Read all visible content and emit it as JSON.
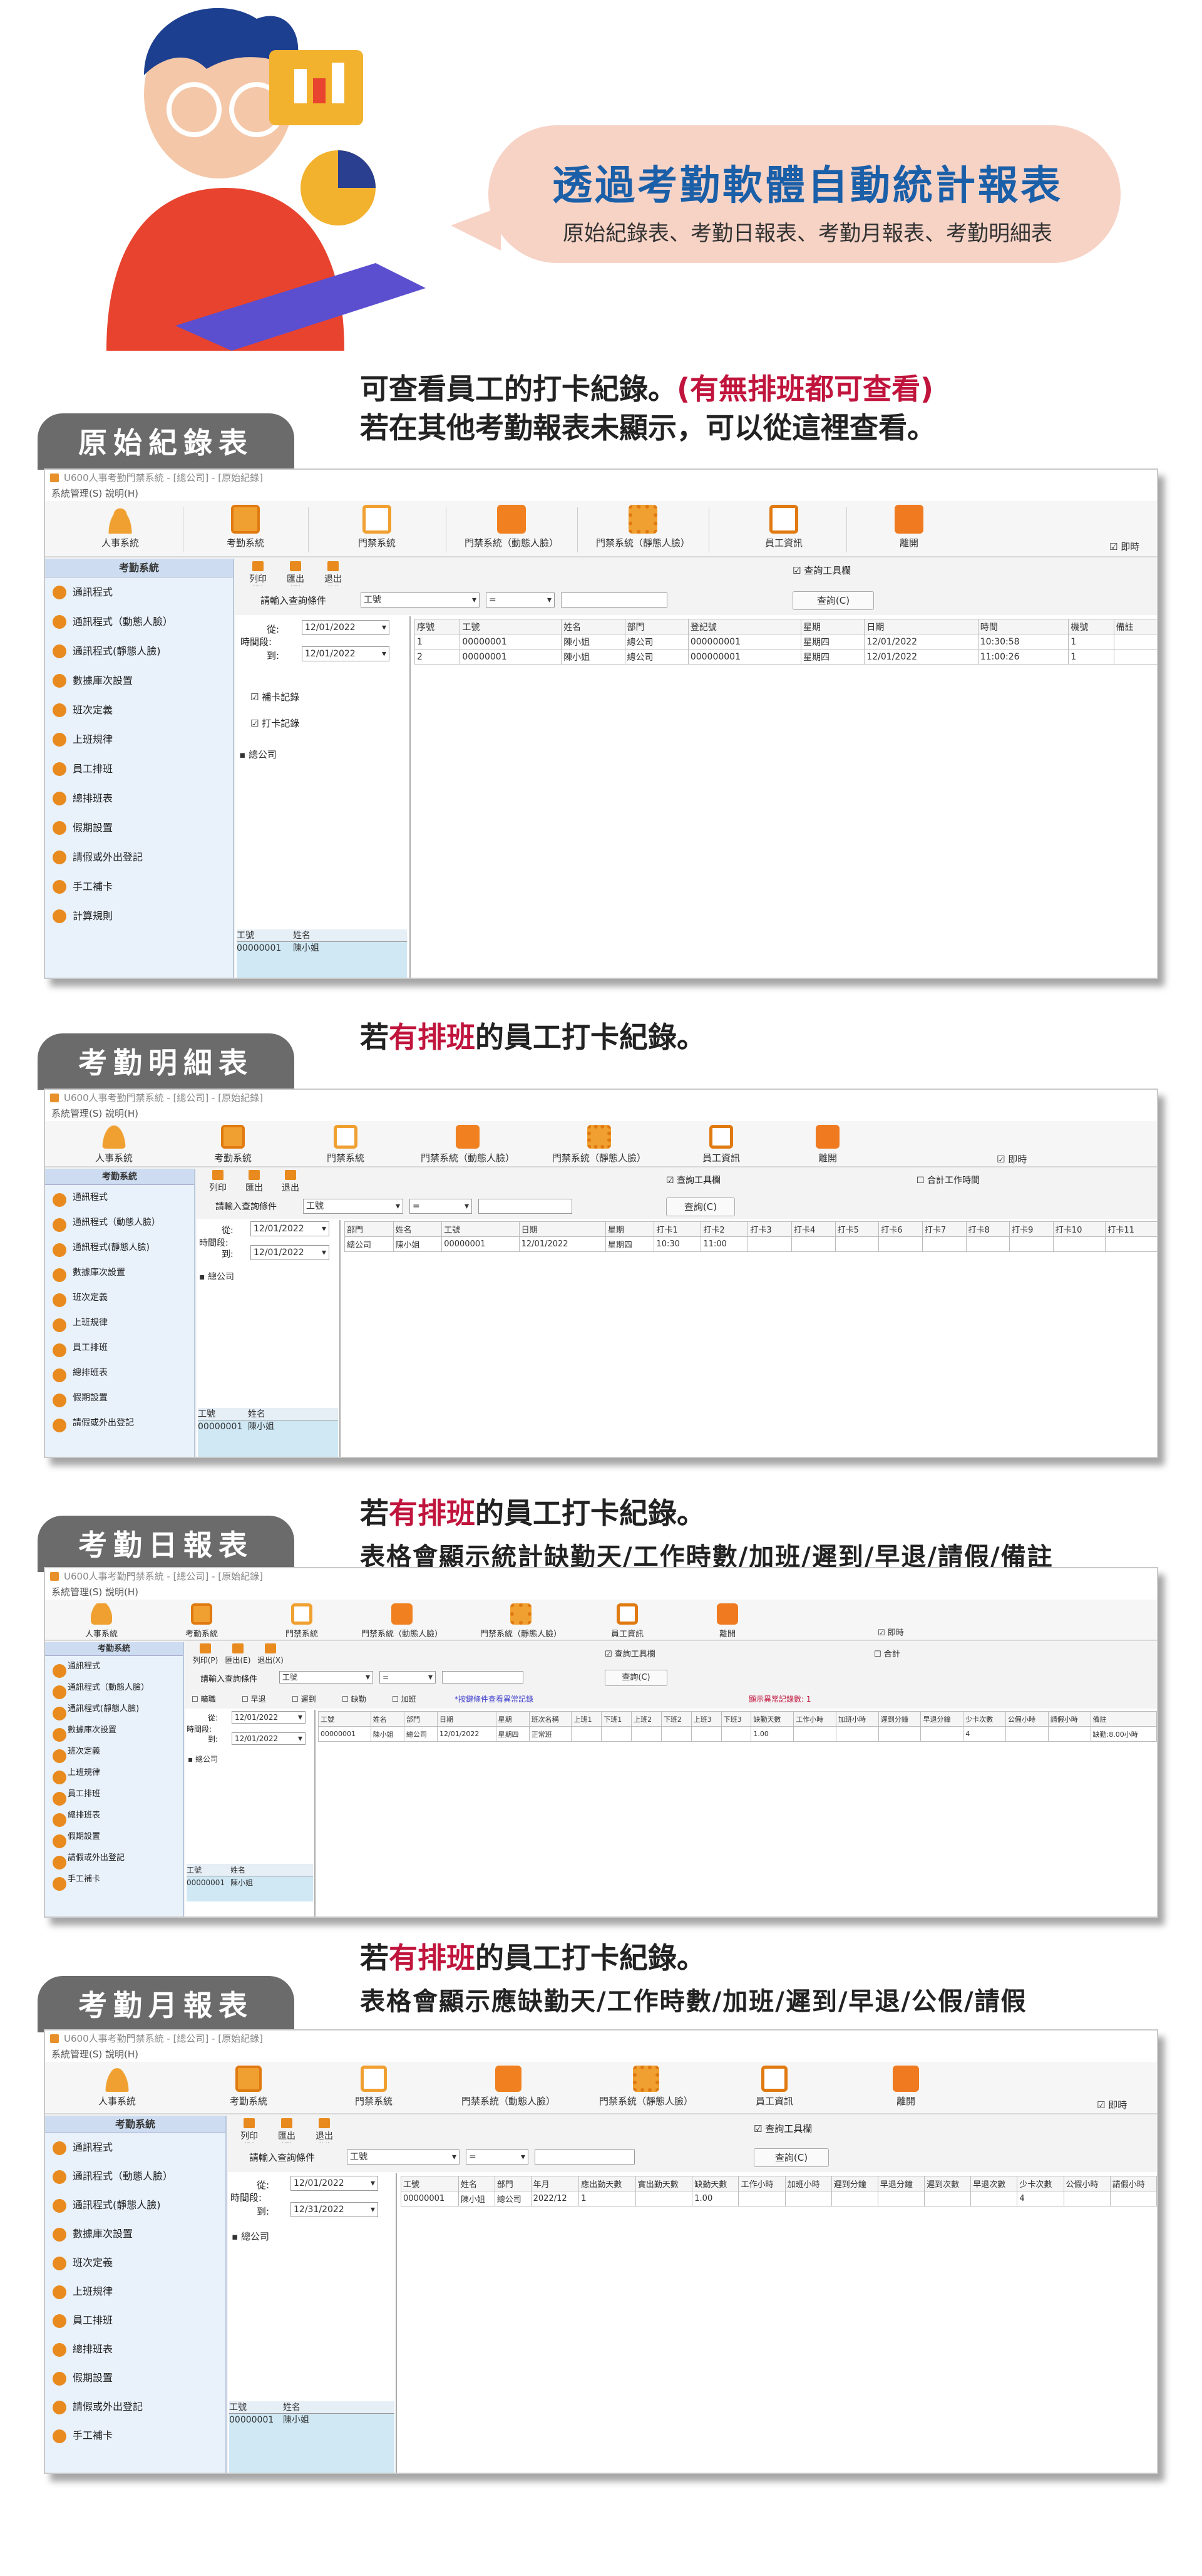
{
  "hero": {
    "title": "透過考勤軟體自動統計報表",
    "subtitle": "原始紀錄表、考勤日報表、考勤月報表、考勤明細表"
  },
  "colors": {
    "accent_blue": "#1a5fa8",
    "accent_red": "#c0143c",
    "bubble": "#f7d3c6",
    "tab_gray": "#6b6b6b",
    "icon_orange": "#e88a1e"
  },
  "app": {
    "title": "U600人事考勤門禁系統 - [總公司] - [原始紀錄]",
    "menu": "系統管理(S)  說明(H)",
    "toolbar": [
      "人事系統",
      "考勤系統",
      "門禁系統",
      "門禁系統（動態人臉）",
      "門禁系統（靜態人臉）",
      "員工資訊",
      "離開"
    ],
    "realtime": "即時",
    "side_header": "考勤系統",
    "side_items": [
      "通訊程式",
      "通訊程式（動態人臉）",
      "通訊程式(靜態人臉)",
      "數據庫次設置",
      "班次定義",
      "上班規律",
      "員工排班",
      "總排班表",
      "假期設置",
      "請假或外出登記",
      "手工補卡",
      "計算規則"
    ],
    "buttons": {
      "print": "列印(P)",
      "export": "匯出(E)",
      "exit": "退出(X)",
      "query": "查詢(C)"
    },
    "show_worktool": "查詢工具欄",
    "query_label": "請輸入查詢條件",
    "query_field": "工號",
    "query_op": "=",
    "period_label": "時間段:",
    "from_label": "從:",
    "to_label": "到:",
    "date_from": "12/01/2022",
    "date_to": "12/01/2022",
    "date_to_month": "12/31/2022",
    "chk_fill": "補卡記錄",
    "chk_punch": "打卡記錄",
    "tree_root": "總公司",
    "emp_header": [
      "工號",
      "姓名"
    ],
    "emp_row": [
      "00000001",
      "陳小姐"
    ]
  },
  "section1": {
    "tab": "原始紀錄表",
    "line1": "可查看員工的打卡紀錄。",
    "line1_red": "(有無排班都可查看)",
    "line2": "若在其他考勤報表未顯示，可以從這裡查看。",
    "headers": [
      "序號",
      "工號",
      "姓名",
      "部門",
      "登記號",
      "星期",
      "日期",
      "時間",
      "機號",
      "備註"
    ],
    "rows": [
      [
        "1",
        "00000001",
        "陳小姐",
        "總公司",
        "000000001",
        "星期四",
        "12/01/2022",
        "10:30:58",
        "1",
        ""
      ],
      [
        "2",
        "00000001",
        "陳小姐",
        "總公司",
        "000000001",
        "星期四",
        "12/01/2022",
        "11:00:26",
        "1",
        ""
      ]
    ]
  },
  "section2": {
    "tab": "考勤明細表",
    "pre": "若",
    "red": "有排班",
    "post": "的員工打卡紀錄。",
    "merge_worktool": "合計工作時間",
    "headers": [
      "部門",
      "姓名",
      "工號",
      "日期",
      "星期",
      "打卡1",
      "打卡2",
      "打卡3",
      "打卡4",
      "打卡5",
      "打卡6",
      "打卡7",
      "打卡8",
      "打卡9",
      "打卡10",
      "打卡11"
    ],
    "row": [
      "總公司",
      "陳小姐",
      "00000001",
      "12/01/2022",
      "星期四",
      "10:30",
      "11:00",
      "",
      "",
      "",
      "",
      "",
      "",
      "",
      "",
      ""
    ]
  },
  "section3": {
    "tab": "考勤日報表",
    "pre": "若",
    "red": "有排班",
    "post": "的員工打卡紀錄。",
    "line2": "表格會顯示統計缺勤天/工作時數/加班/遲到/早退/請假/備註",
    "total": "合計",
    "filters": [
      "曠職",
      "早退",
      "遲到",
      "缺勤",
      "加班"
    ],
    "note": "*按鍵條件查看異常記錄",
    "anomaly": "顯示異常記錄數: 1",
    "headers": [
      "工號",
      "姓名",
      "部門",
      "日期",
      "星期",
      "班次名稱",
      "上班1",
      "下班1",
      "上班2",
      "下班2",
      "上班3",
      "下班3",
      "缺勤天數",
      "工作小時",
      "加班小時",
      "遲到分鐘",
      "早退分鐘",
      "少卡次數",
      "公假小時",
      "請假小時",
      "備註"
    ],
    "row": [
      "00000001",
      "陳小姐",
      "總公司",
      "12/01/2022",
      "星期四",
      "正常班",
      "",
      "",
      "",
      "",
      "",
      "",
      "1.00",
      "",
      "",
      "",
      "",
      "4",
      "",
      "",
      "缺勤:8.00小時"
    ]
  },
  "section4": {
    "tab": "考勤月報表",
    "pre": "若",
    "red": "有排班",
    "post": "的員工打卡紀錄。",
    "line2": "表格會顯示應缺勤天/工作時數/加班/遲到/早退/公假/請假",
    "headers": [
      "工號",
      "姓名",
      "部門",
      "年月",
      "應出勤天數",
      "實出勤天數",
      "缺勤天數",
      "工作小時",
      "加班小時",
      "遲到分鐘",
      "早退分鐘",
      "遲到次數",
      "早退次數",
      "少卡次數",
      "公假小時",
      "請假小時"
    ],
    "row": [
      "00000001",
      "陳小姐",
      "總公司",
      "2022/12",
      "1",
      "",
      "1.00",
      "",
      "",
      "",
      "",
      "",
      "",
      "4",
      "",
      ""
    ]
  }
}
